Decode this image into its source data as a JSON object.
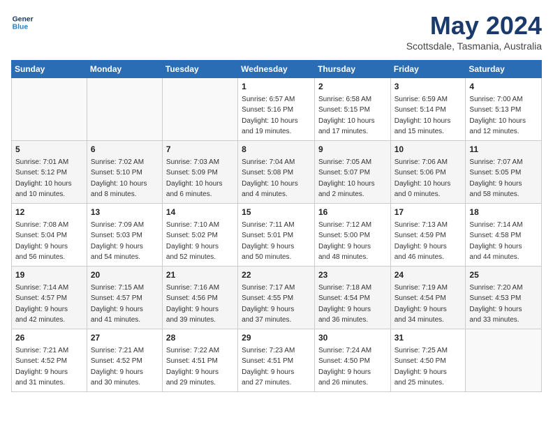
{
  "header": {
    "logo_line1": "General",
    "logo_line2": "Blue",
    "month": "May 2024",
    "location": "Scottsdale, Tasmania, Australia"
  },
  "days_of_week": [
    "Sunday",
    "Monday",
    "Tuesday",
    "Wednesday",
    "Thursday",
    "Friday",
    "Saturday"
  ],
  "weeks": [
    [
      {
        "day": "",
        "content": ""
      },
      {
        "day": "",
        "content": ""
      },
      {
        "day": "",
        "content": ""
      },
      {
        "day": "1",
        "content": "Sunrise: 6:57 AM\nSunset: 5:16 PM\nDaylight: 10 hours\nand 19 minutes."
      },
      {
        "day": "2",
        "content": "Sunrise: 6:58 AM\nSunset: 5:15 PM\nDaylight: 10 hours\nand 17 minutes."
      },
      {
        "day": "3",
        "content": "Sunrise: 6:59 AM\nSunset: 5:14 PM\nDaylight: 10 hours\nand 15 minutes."
      },
      {
        "day": "4",
        "content": "Sunrise: 7:00 AM\nSunset: 5:13 PM\nDaylight: 10 hours\nand 12 minutes."
      }
    ],
    [
      {
        "day": "5",
        "content": "Sunrise: 7:01 AM\nSunset: 5:12 PM\nDaylight: 10 hours\nand 10 minutes."
      },
      {
        "day": "6",
        "content": "Sunrise: 7:02 AM\nSunset: 5:10 PM\nDaylight: 10 hours\nand 8 minutes."
      },
      {
        "day": "7",
        "content": "Sunrise: 7:03 AM\nSunset: 5:09 PM\nDaylight: 10 hours\nand 6 minutes."
      },
      {
        "day": "8",
        "content": "Sunrise: 7:04 AM\nSunset: 5:08 PM\nDaylight: 10 hours\nand 4 minutes."
      },
      {
        "day": "9",
        "content": "Sunrise: 7:05 AM\nSunset: 5:07 PM\nDaylight: 10 hours\nand 2 minutes."
      },
      {
        "day": "10",
        "content": "Sunrise: 7:06 AM\nSunset: 5:06 PM\nDaylight: 10 hours\nand 0 minutes."
      },
      {
        "day": "11",
        "content": "Sunrise: 7:07 AM\nSunset: 5:05 PM\nDaylight: 9 hours\nand 58 minutes."
      }
    ],
    [
      {
        "day": "12",
        "content": "Sunrise: 7:08 AM\nSunset: 5:04 PM\nDaylight: 9 hours\nand 56 minutes."
      },
      {
        "day": "13",
        "content": "Sunrise: 7:09 AM\nSunset: 5:03 PM\nDaylight: 9 hours\nand 54 minutes."
      },
      {
        "day": "14",
        "content": "Sunrise: 7:10 AM\nSunset: 5:02 PM\nDaylight: 9 hours\nand 52 minutes."
      },
      {
        "day": "15",
        "content": "Sunrise: 7:11 AM\nSunset: 5:01 PM\nDaylight: 9 hours\nand 50 minutes."
      },
      {
        "day": "16",
        "content": "Sunrise: 7:12 AM\nSunset: 5:00 PM\nDaylight: 9 hours\nand 48 minutes."
      },
      {
        "day": "17",
        "content": "Sunrise: 7:13 AM\nSunset: 4:59 PM\nDaylight: 9 hours\nand 46 minutes."
      },
      {
        "day": "18",
        "content": "Sunrise: 7:14 AM\nSunset: 4:58 PM\nDaylight: 9 hours\nand 44 minutes."
      }
    ],
    [
      {
        "day": "19",
        "content": "Sunrise: 7:14 AM\nSunset: 4:57 PM\nDaylight: 9 hours\nand 42 minutes."
      },
      {
        "day": "20",
        "content": "Sunrise: 7:15 AM\nSunset: 4:57 PM\nDaylight: 9 hours\nand 41 minutes."
      },
      {
        "day": "21",
        "content": "Sunrise: 7:16 AM\nSunset: 4:56 PM\nDaylight: 9 hours\nand 39 minutes."
      },
      {
        "day": "22",
        "content": "Sunrise: 7:17 AM\nSunset: 4:55 PM\nDaylight: 9 hours\nand 37 minutes."
      },
      {
        "day": "23",
        "content": "Sunrise: 7:18 AM\nSunset: 4:54 PM\nDaylight: 9 hours\nand 36 minutes."
      },
      {
        "day": "24",
        "content": "Sunrise: 7:19 AM\nSunset: 4:54 PM\nDaylight: 9 hours\nand 34 minutes."
      },
      {
        "day": "25",
        "content": "Sunrise: 7:20 AM\nSunset: 4:53 PM\nDaylight: 9 hours\nand 33 minutes."
      }
    ],
    [
      {
        "day": "26",
        "content": "Sunrise: 7:21 AM\nSunset: 4:52 PM\nDaylight: 9 hours\nand 31 minutes."
      },
      {
        "day": "27",
        "content": "Sunrise: 7:21 AM\nSunset: 4:52 PM\nDaylight: 9 hours\nand 30 minutes."
      },
      {
        "day": "28",
        "content": "Sunrise: 7:22 AM\nSunset: 4:51 PM\nDaylight: 9 hours\nand 29 minutes."
      },
      {
        "day": "29",
        "content": "Sunrise: 7:23 AM\nSunset: 4:51 PM\nDaylight: 9 hours\nand 27 minutes."
      },
      {
        "day": "30",
        "content": "Sunrise: 7:24 AM\nSunset: 4:50 PM\nDaylight: 9 hours\nand 26 minutes."
      },
      {
        "day": "31",
        "content": "Sunrise: 7:25 AM\nSunset: 4:50 PM\nDaylight: 9 hours\nand 25 minutes."
      },
      {
        "day": "",
        "content": ""
      }
    ]
  ]
}
